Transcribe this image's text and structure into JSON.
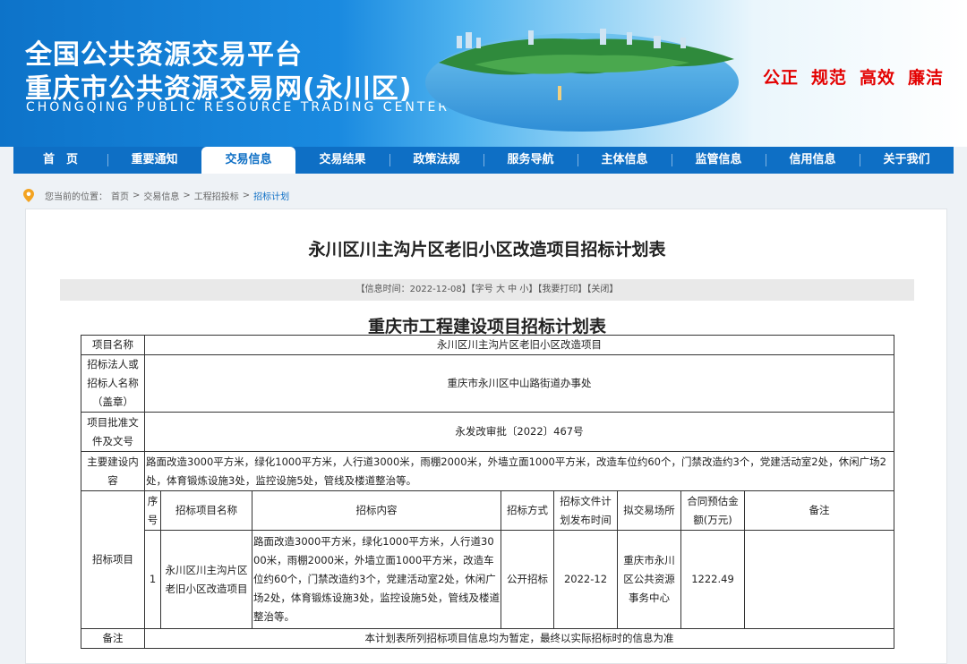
{
  "site": {
    "title_line1": "全国公共资源交易平台",
    "title_line2": "重庆市公共资源交易网(永川区)",
    "title_en": "CHONGQING PUBLIC RESOURCE TRADING CENTER",
    "slogans": [
      "公正",
      "规范",
      "高效",
      "廉洁"
    ]
  },
  "nav": [
    "首　页",
    "重要通知",
    "交易信息",
    "交易结果",
    "政策法规",
    "服务导航",
    "主体信息",
    "监管信息",
    "信用信息",
    "关于我们"
  ],
  "nav_active": "交易信息",
  "breadcrumb": {
    "prefix": "您当前的位置：",
    "items": [
      "首页",
      "交易信息",
      "工程招投标",
      "招标计划"
    ],
    "sep": ">"
  },
  "article": {
    "title": "永川区川主沟片区老旧小区改造项目招标计划表",
    "info_bar": "【信息时间：2022-12-08】【字号 大 中 小】【我要打印】【关闭】",
    "table_title": "重庆市工程建设项目招标计划表"
  },
  "table": {
    "project_name_label": "项目名称",
    "project_name": "永川区川主沟片区老旧小区改造项目",
    "tenderer_label": "招标法人或招标人名称（盖章）",
    "tenderer": "重庆市永川区中山路街道办事处",
    "approval_label": "项目批准文件及文号",
    "approval": "永发改审批〔2022〕467号",
    "content_label": "主要建设内容",
    "content": "路面改造3000平方米，绿化1000平方米，人行道3000米，雨棚2000米，外墙立面1000平方米，改造车位约60个，门禁改造约3个，党建活动室2处，休闲广场2处，体育锻炼设施3处，监控设施5处，管线及楼道整治等。",
    "items_label": "招标项目",
    "headers": [
      "序号",
      "招标项目名称",
      "招标内容",
      "招标方式",
      "招标文件计划发布时间",
      "拟交易场所",
      "合同预估金额(万元)",
      "备注"
    ],
    "row": {
      "no": "1",
      "name": "永川区川主沟片区老旧小区改造项目",
      "content": "路面改造3000平方米，绿化1000平方米，人行道3000米，雨棚2000米，外墙立面1000平方米，改造车位约60个，门禁改造约3个，党建活动室2处，休闲广场2处，体育锻炼设施3处，监控设施5处，管线及楼道整治等。",
      "method": "公开招标",
      "publish_time": "2022-12",
      "venue": "重庆市永川区公共资源事务中心",
      "amount": "1222.49",
      "remark": ""
    },
    "note_label": "备注",
    "note": "本计划表所列招标项目信息均为暂定，最终以实际招标时的信息为准"
  },
  "colors": {
    "nav_blue": "#0e6fc5",
    "slogan_red": "#e30000"
  }
}
